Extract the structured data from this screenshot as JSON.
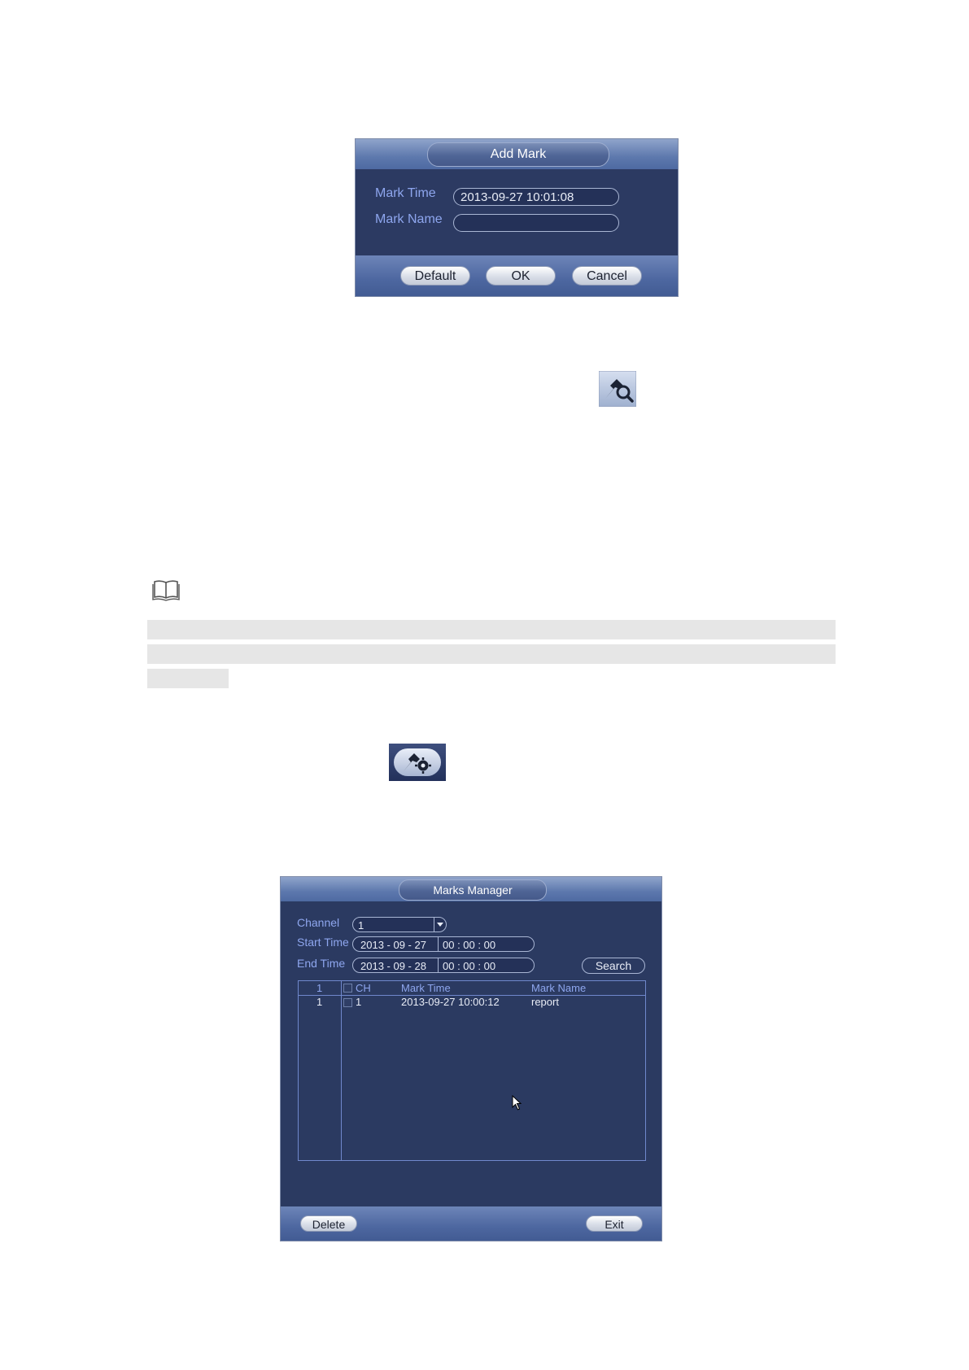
{
  "add_mark": {
    "title": "Add Mark",
    "mark_time_label": "Mark Time",
    "mark_time_value": "2013-09-27 10:01:08",
    "mark_name_label": "Mark Name",
    "mark_name_value": "",
    "buttons": {
      "default": "Default",
      "ok": "OK",
      "cancel": "Cancel"
    }
  },
  "icons": {
    "mark_search": "mark-search-icon",
    "note": "book-icon",
    "mark_manager": "mark-manager-icon"
  },
  "marks_manager": {
    "title": "Marks Manager",
    "channel_label": "Channel",
    "channel_value": "1",
    "start_time_label": "Start Time",
    "start_date": "2013 - 09 - 27",
    "start_time": "00 :  00 :  00",
    "end_time_label": "End Time",
    "end_date": "2013 - 09 - 28",
    "end_time": "00 :  00 :  00",
    "search_button": "Search",
    "columns": {
      "index": "1",
      "ch": "CH",
      "mark_time": "Mark Time",
      "mark_name": "Mark Name"
    },
    "rows": [
      {
        "index": "1",
        "ch": "1",
        "mark_time": "2013-09-27 10:00:12",
        "mark_name": "report"
      }
    ],
    "delete_button": "Delete",
    "exit_button": "Exit"
  },
  "colors": {
    "panel": "#2b3a61",
    "label_blue": "#8ea6ee",
    "header_blue": "#5d78ad"
  }
}
